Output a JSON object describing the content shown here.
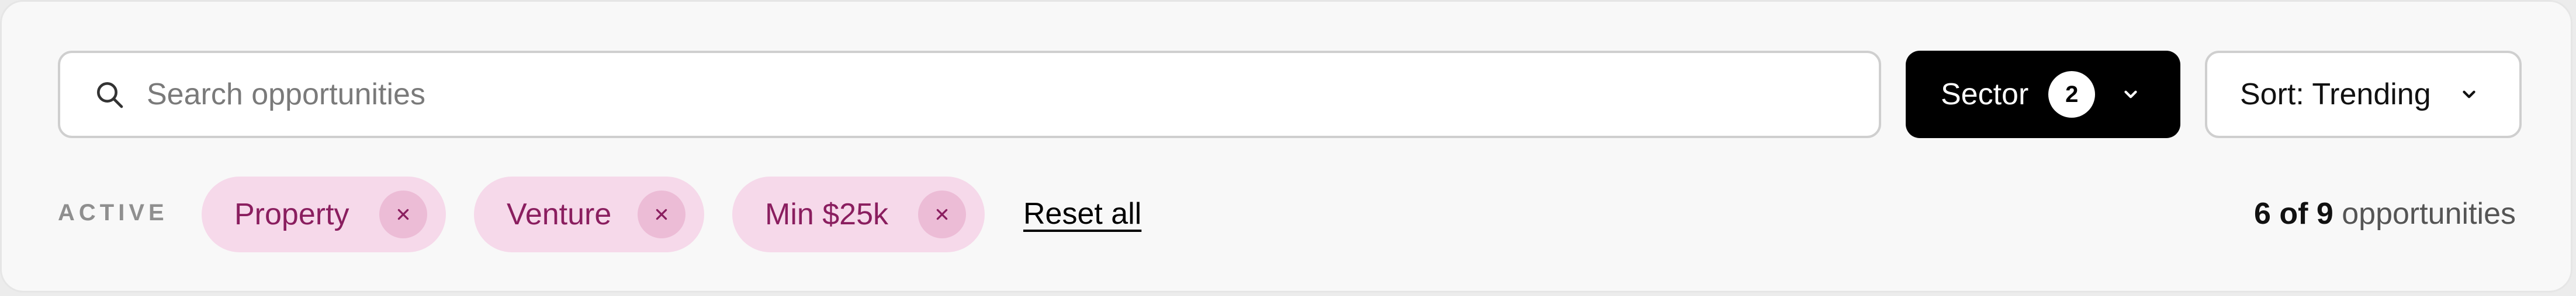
{
  "search": {
    "placeholder": "Search opportunities",
    "value": ""
  },
  "sector_button": {
    "label": "Sector",
    "count": "2"
  },
  "sort_button": {
    "label": "Sort: Trending"
  },
  "filters": {
    "active_label": "ACTIVE",
    "chips": [
      {
        "label": "Property"
      },
      {
        "label": "Venture"
      },
      {
        "label": "Min $25k"
      }
    ],
    "reset_label": "Reset all"
  },
  "results": {
    "shown": "6",
    "of_word": "of",
    "total": "9",
    "noun": "opportunities"
  },
  "colors": {
    "chip_bg": "#f6d9ea",
    "chip_text": "#8a1e5f",
    "chip_close_bg": "#ecbcd6",
    "primary_button_bg": "#000000"
  },
  "icons": {
    "search": "search-icon",
    "chevron": "chevron-down-icon",
    "close": "close-icon"
  }
}
